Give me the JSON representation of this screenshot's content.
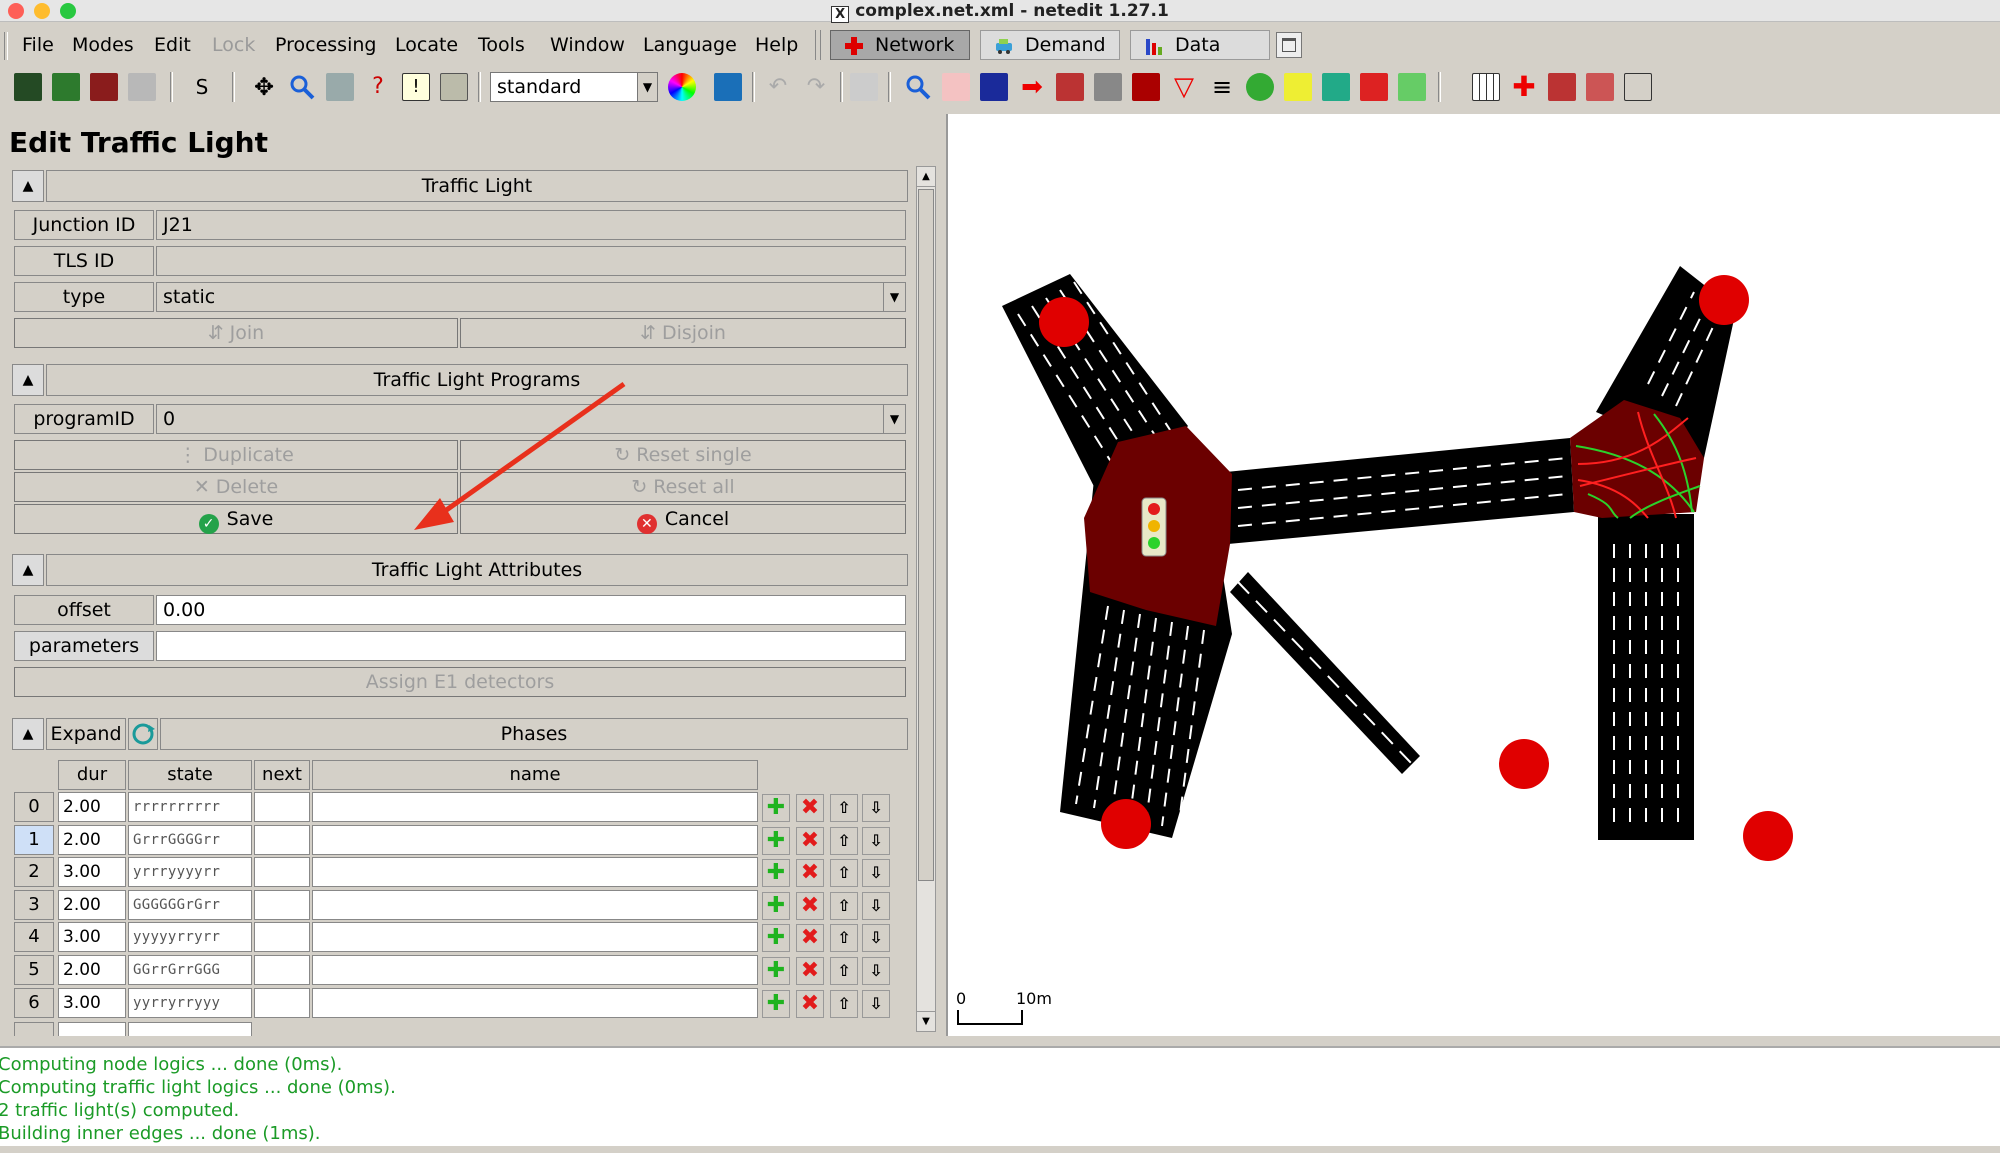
{
  "window": {
    "title": "complex.net.xml - netedit 1.27.1",
    "x11_glyph": "X"
  },
  "menu": {
    "items": [
      "File",
      "Modes",
      "Edit",
      "Lock",
      "Processing",
      "Locate",
      "Tools",
      "Window",
      "Language",
      "Help"
    ],
    "modes": [
      "Network",
      "Demand",
      "Data"
    ],
    "active_mode": "Network"
  },
  "toolbar": {
    "s_label": "S",
    "scheme": "standard"
  },
  "panel": {
    "title": "Edit Traffic Light",
    "traffic_light": {
      "header": "Traffic Light",
      "junction_id_label": "Junction ID",
      "junction_id": "J21",
      "tls_id_label": "TLS ID",
      "tls_id": "",
      "type_label": "type",
      "type": "static",
      "join_label": "Join",
      "disjoin_label": "Disjoin"
    },
    "programs": {
      "header": "Traffic Light Programs",
      "program_id_label": "programID",
      "program_id": "0",
      "duplicate_label": "Duplicate",
      "reset_single_label": "Reset single",
      "delete_label": "Delete",
      "reset_all_label": "Reset all",
      "save_label": "Save",
      "cancel_label": "Cancel"
    },
    "attributes": {
      "header": "Traffic Light Attributes",
      "offset_label": "offset",
      "offset": "0.00",
      "parameters_label": "parameters",
      "parameters": "",
      "assign_label": "Assign E1 detectors"
    },
    "phases": {
      "expand_label": "Expand",
      "header": "Phases",
      "columns": [
        "dur",
        "state",
        "next",
        "name"
      ],
      "rows": [
        {
          "idx": "0",
          "dur": "2.00",
          "state": "rrrrrrrrrr",
          "next": "",
          "name": ""
        },
        {
          "idx": "1",
          "dur": "2.00",
          "state": "GrrrGGGGrr",
          "next": "",
          "name": ""
        },
        {
          "idx": "2",
          "dur": "3.00",
          "state": "yrrryyyyrr",
          "next": "",
          "name": ""
        },
        {
          "idx": "3",
          "dur": "2.00",
          "state": "GGGGGGrGrr",
          "next": "",
          "name": ""
        },
        {
          "idx": "4",
          "dur": "3.00",
          "state": "yyyyyrryrr",
          "next": "",
          "name": ""
        },
        {
          "idx": "5",
          "dur": "2.00",
          "state": "GGrrGrrGGG",
          "next": "",
          "name": ""
        },
        {
          "idx": "6",
          "dur": "3.00",
          "state": "yyrryrryyy",
          "next": "",
          "name": ""
        }
      ],
      "selected_index": "1"
    }
  },
  "canvas": {
    "scale_zero": "0",
    "scale_label": "10m"
  },
  "log": {
    "lines": [
      "Computing node logics ... done (0ms).",
      "Computing traffic light logics ... done (0ms).",
      "2 traffic light(s) computed.",
      "Building inner edges ... done (1ms)."
    ]
  },
  "colors": {
    "junction_fill": "#6b0000",
    "road": "#000000",
    "dead_end": "#e00000",
    "log_text": "#1b9b27",
    "arrow": "#e8301c"
  }
}
